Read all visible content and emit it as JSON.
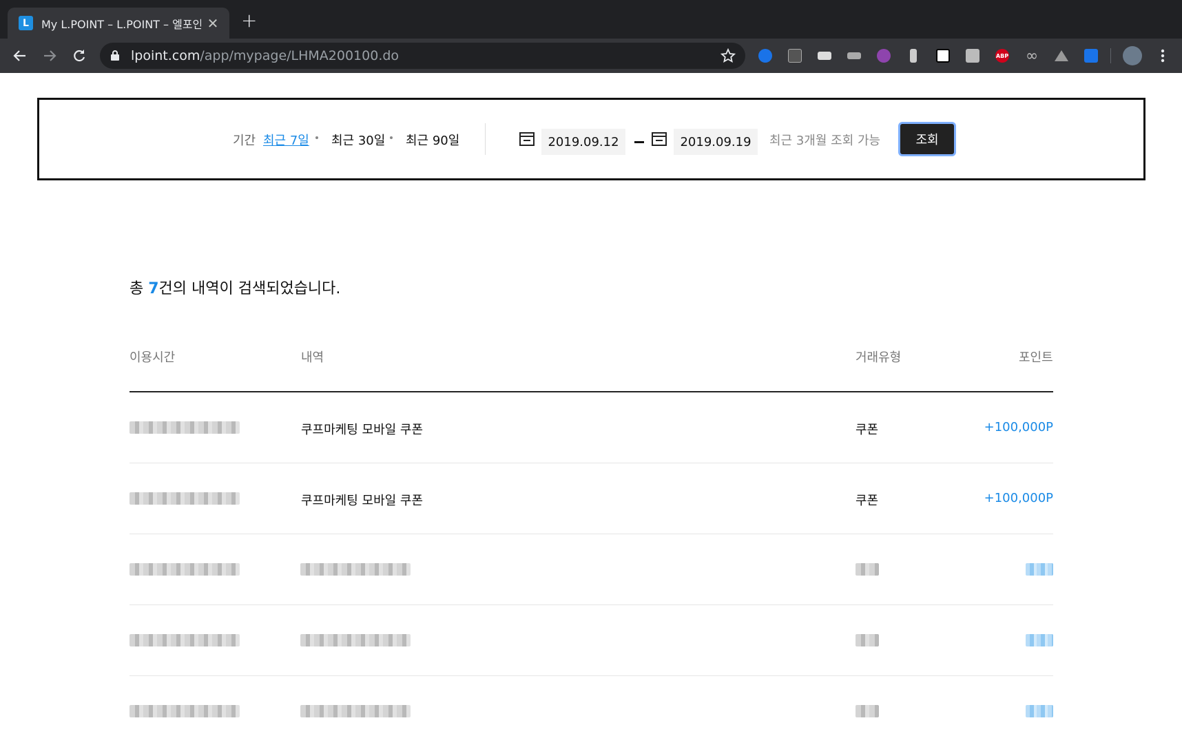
{
  "browser": {
    "tab_title": "My L.POINT – L.POINT – 엘포인트",
    "favicon_letter": "L",
    "new_tab_symbol": "+",
    "close_symbol": "✕",
    "url_host": "lpoint.com",
    "url_path": "/app/mypage/LHMA200100.do",
    "extensions": [
      "download-icon",
      "dictionary-icon",
      "screen-icon",
      "tag-icon",
      "stop-icon",
      "pen-icon",
      "notion-icon",
      "hand-icon",
      "abp-icon",
      "infinity-icon",
      "drive-icon",
      "check-icon"
    ],
    "abp_text": "ABP"
  },
  "filter": {
    "period_label": "기간",
    "options": [
      "최근 7일",
      "최근 30일",
      "최근 90일"
    ],
    "active_option": "최근 7일",
    "start_date": "2019.09.12",
    "end_date": "2019.09.19",
    "hint": "최근 3개월 조회 가능",
    "search_button": "조회"
  },
  "results": {
    "summary_prefix": "총 ",
    "count": "7",
    "summary_suffix": "건의 내역이 검색되었습니다.",
    "columns": [
      "이용시간",
      "내역",
      "거래유형",
      "포인트"
    ],
    "rows": [
      {
        "detail": "쿠프마케팅 모바일 쿠폰",
        "type": "쿠폰",
        "points": "+100,000P"
      },
      {
        "detail": "쿠프마케팅 모바일 쿠폰",
        "type": "쿠폰",
        "points": "+100,000P"
      }
    ]
  },
  "colors": {
    "accent": "#1a8ae6",
    "chrome_dark": "#202124",
    "chrome_toolbar": "#35363a"
  }
}
